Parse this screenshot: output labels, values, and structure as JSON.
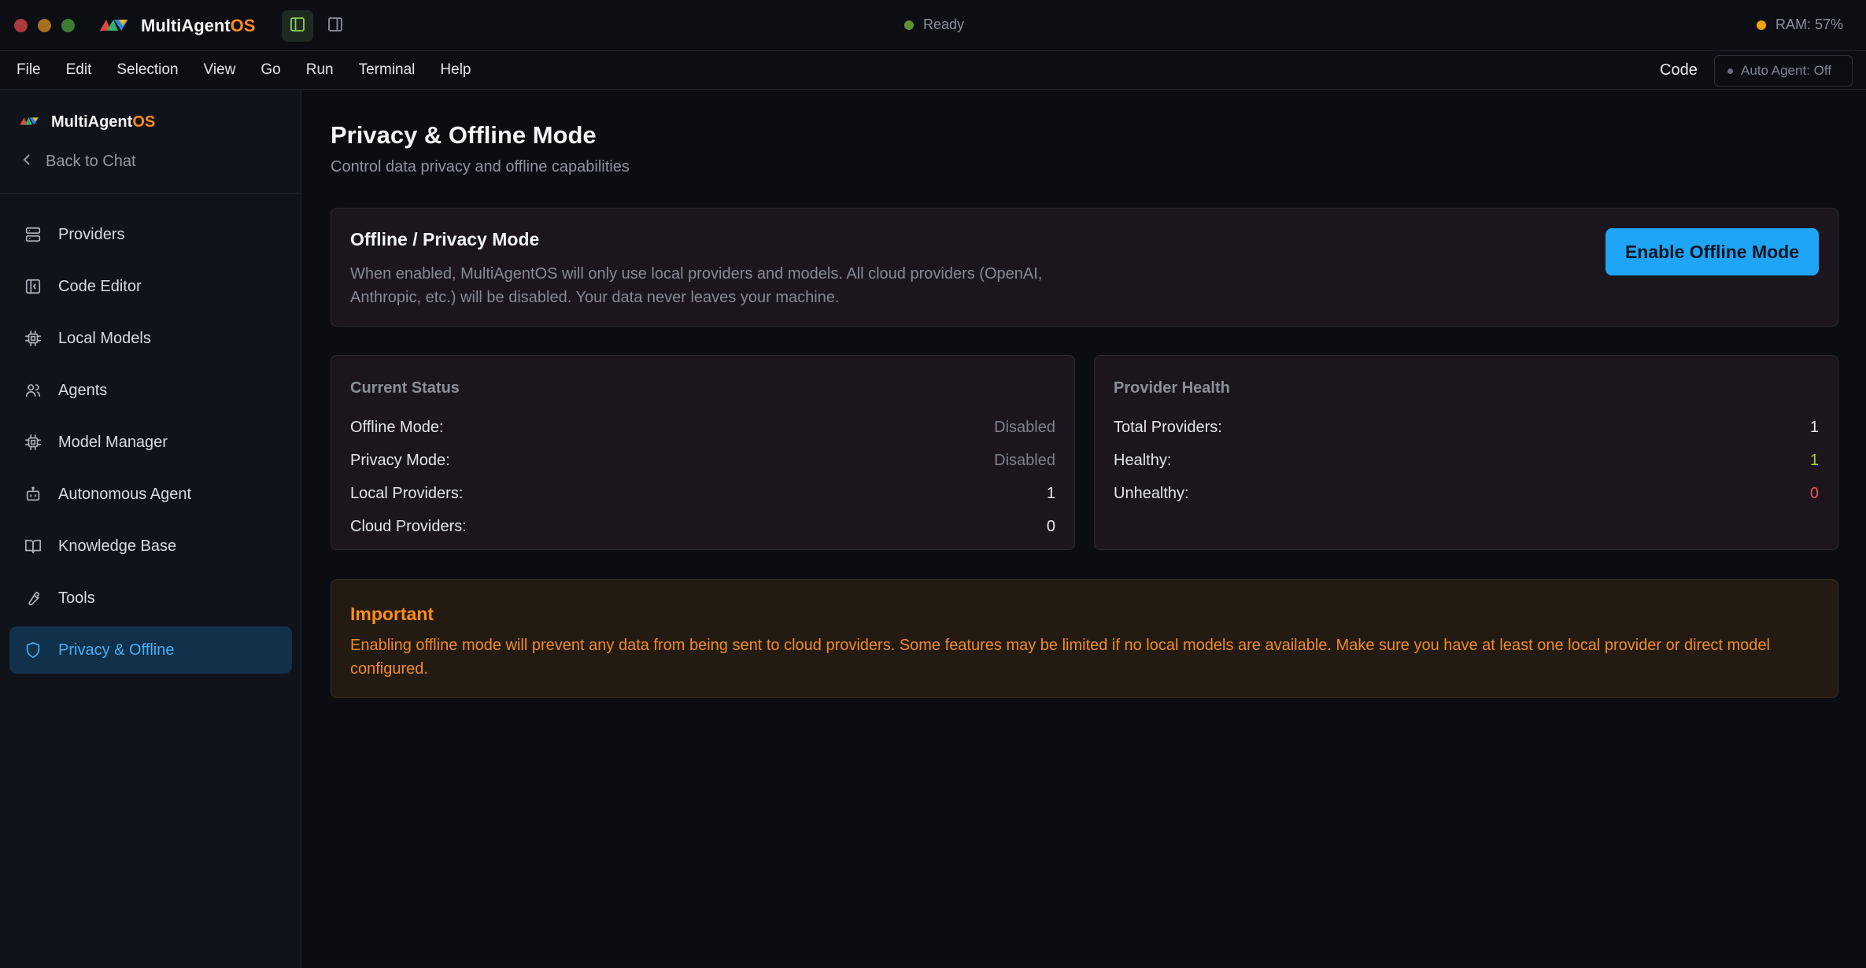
{
  "titlebar": {
    "app_name": "MultiAgent",
    "app_name_suffix": "OS",
    "status": "Ready",
    "status_color": "#5f8f2e",
    "ram": "RAM: 57%",
    "ram_color": "#f5a20a"
  },
  "menubar": {
    "items": [
      "File",
      "Edit",
      "Selection",
      "View",
      "Go",
      "Run",
      "Terminal",
      "Help"
    ],
    "code_label": "Code",
    "auto_agent": "Auto Agent: Off"
  },
  "sidebar": {
    "brand": "MultiAgent",
    "brand_suffix": "OS",
    "back": "Back to Chat",
    "items": [
      {
        "label": "Providers",
        "icon": "server-icon"
      },
      {
        "label": "Code Editor",
        "icon": "code-editor-icon"
      },
      {
        "label": "Local Models",
        "icon": "cpu-icon"
      },
      {
        "label": "Agents",
        "icon": "users-icon"
      },
      {
        "label": "Model Manager",
        "icon": "cpu-icon"
      },
      {
        "label": "Autonomous Agent",
        "icon": "bot-icon"
      },
      {
        "label": "Knowledge Base",
        "icon": "book-icon"
      },
      {
        "label": "Tools",
        "icon": "wrench-icon"
      },
      {
        "label": "Privacy & Offline",
        "icon": "shield-icon",
        "active": true
      }
    ]
  },
  "main": {
    "title": "Privacy & Offline Mode",
    "subtitle": "Control data privacy and offline capabilities",
    "offline_card": {
      "title": "Offline / Privacy Mode",
      "description": "When enabled, MultiAgentOS will only use local providers and models. All cloud providers (OpenAI, Anthropic, etc.) will be disabled. Your data never leaves your machine.",
      "button": "Enable Offline Mode"
    },
    "current_status": {
      "title": "Current Status",
      "rows": [
        {
          "label": "Offline Mode:",
          "value": "Disabled"
        },
        {
          "label": "Privacy Mode:",
          "value": "Disabled"
        },
        {
          "label": "Local Providers:",
          "value": "1"
        },
        {
          "label": "Cloud Providers:",
          "value": "0"
        }
      ]
    },
    "provider_health": {
      "title": "Provider Health",
      "rows": [
        {
          "label": "Total Providers:",
          "value": "1"
        },
        {
          "label": "Healthy:",
          "value": "1"
        },
        {
          "label": "Unhealthy:",
          "value": "0"
        }
      ]
    },
    "important": {
      "title": "Important",
      "text": "Enabling offline mode will prevent any data from being sent to cloud providers. Some features may be limited if no local models are available. Make sure you have at least one local provider or direct model configured."
    }
  }
}
